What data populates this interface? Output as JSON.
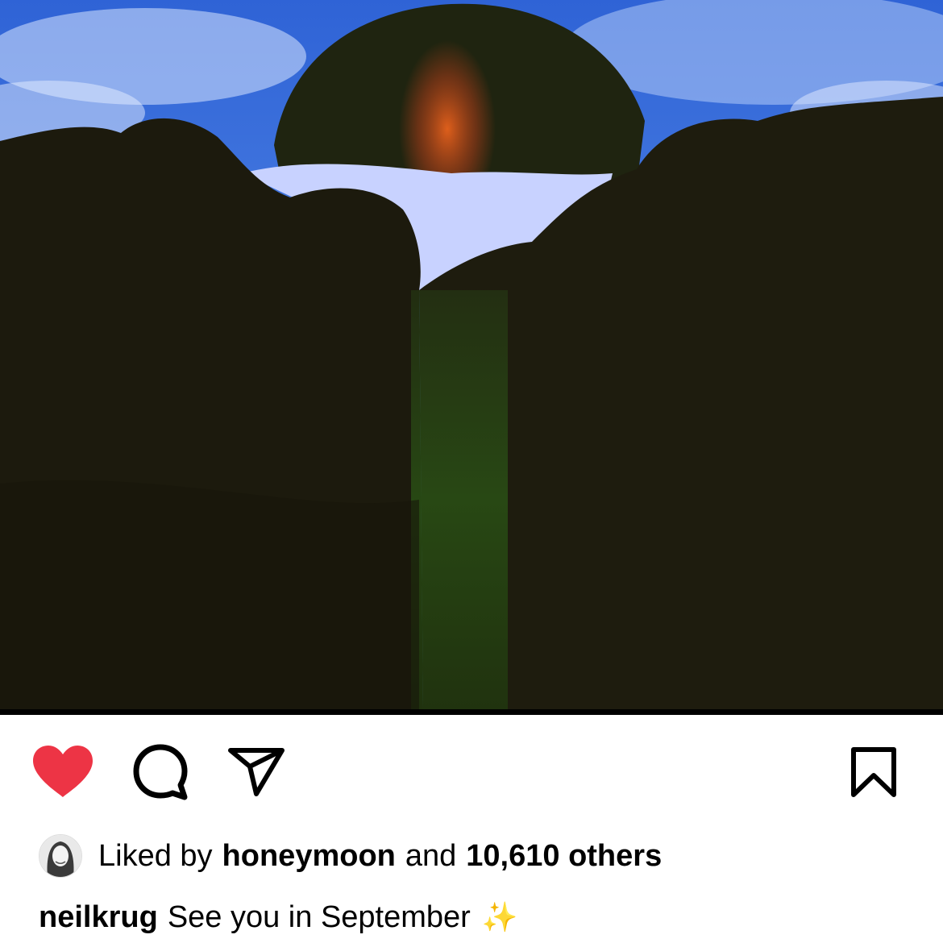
{
  "post": {
    "image_alt": "dark rocky coastline with waves and a green light leak",
    "colors": {
      "sky": "#3f7fe0",
      "rock": "#1c1a0d",
      "foam": "#c9d4ff",
      "glow": "#d9541a",
      "heart": "#ed3445"
    }
  },
  "actions": {
    "like": {
      "icon": "heart-icon",
      "state": "liked"
    },
    "comment": {
      "icon": "comment-icon"
    },
    "share": {
      "icon": "paper-plane-icon"
    },
    "save": {
      "icon": "bookmark-icon"
    }
  },
  "likes": {
    "prefix": "Liked by",
    "user": "honeymoon",
    "connector": "and",
    "count_text": "10,610 others"
  },
  "caption": {
    "username": "neilkrug",
    "text": "See you in September",
    "emoji": "✨"
  }
}
